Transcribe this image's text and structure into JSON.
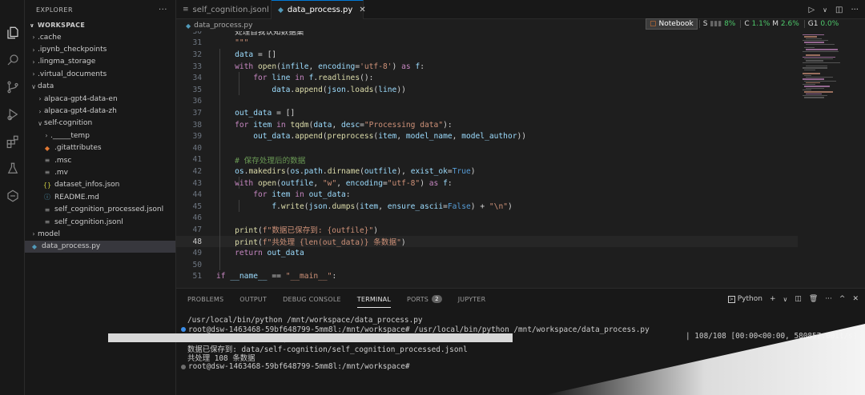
{
  "activity_bar": {
    "icons": [
      "files-icon",
      "search-icon",
      "source-control-icon",
      "run-debug-icon",
      "extensions-icon",
      "testing-icon",
      "remote-explorer-icon"
    ]
  },
  "sidebar": {
    "title": "EXPLORER",
    "workspace": "WORKSPACE",
    "items": [
      {
        "label": ".cache",
        "type": "folder",
        "expanded": false,
        "depth": 1
      },
      {
        "label": ".ipynb_checkpoints",
        "type": "folder",
        "expanded": false,
        "depth": 1
      },
      {
        "label": ".lingma_storage",
        "type": "folder",
        "expanded": false,
        "depth": 1
      },
      {
        "label": ".virtual_documents",
        "type": "folder",
        "expanded": false,
        "depth": 1
      },
      {
        "label": "data",
        "type": "folder",
        "expanded": true,
        "depth": 1
      },
      {
        "label": "alpaca-gpt4-data-en",
        "type": "folder",
        "expanded": false,
        "depth": 2
      },
      {
        "label": "alpaca-gpt4-data-zh",
        "type": "folder",
        "expanded": false,
        "depth": 2
      },
      {
        "label": "self-cognition",
        "type": "folder",
        "expanded": true,
        "depth": 2
      },
      {
        "label": "._____temp",
        "type": "folder",
        "expanded": false,
        "depth": 3
      },
      {
        "label": ".gitattributes",
        "type": "git",
        "depth": 3
      },
      {
        "label": ".msc",
        "type": "file",
        "depth": 3
      },
      {
        "label": ".mv",
        "type": "file",
        "depth": 3
      },
      {
        "label": "dataset_infos.json",
        "type": "json",
        "depth": 3
      },
      {
        "label": "README.md",
        "type": "md",
        "depth": 3
      },
      {
        "label": "self_cognition_processed.jsonl",
        "type": "file",
        "depth": 3
      },
      {
        "label": "self_cognition.jsonl",
        "type": "file",
        "depth": 3
      },
      {
        "label": "model",
        "type": "folder",
        "expanded": false,
        "depth": 1
      },
      {
        "label": "data_process.py",
        "type": "py",
        "depth": 1,
        "active": true
      }
    ]
  },
  "tabs": [
    {
      "label": "self_cognition.jsonl",
      "active": false
    },
    {
      "label": "data_process.py",
      "active": true
    }
  ],
  "breadcrumb": "data_process.py",
  "status_widget": {
    "notebook": "Notebook",
    "s_label": "S",
    "s_value": "8%",
    "c_label": "C",
    "c_value": "1.1%",
    "m_label": "M",
    "m_value": "2.6%",
    "g_label": "G1",
    "g_value": "0.0%"
  },
  "editor": {
    "lines": [
      {
        "n": "30",
        "text": "    处理自我认知数据集"
      },
      {
        "n": "31",
        "text": "    \"\"\""
      },
      {
        "n": "32",
        "text": "    data = []"
      },
      {
        "n": "33",
        "text": "    with open(infile, encoding='utf-8') as f:"
      },
      {
        "n": "34",
        "text": "        for line in f.readlines():"
      },
      {
        "n": "35",
        "text": "            data.append(json.loads(line))"
      },
      {
        "n": "36",
        "text": ""
      },
      {
        "n": "37",
        "text": "    out_data = []"
      },
      {
        "n": "38",
        "text": "    for item in tqdm(data, desc=\"Processing data\"):"
      },
      {
        "n": "39",
        "text": "        out_data.append(preprocess(item, model_name, model_author))"
      },
      {
        "n": "40",
        "text": ""
      },
      {
        "n": "41",
        "text": "    # 保存处理后的数据"
      },
      {
        "n": "42",
        "text": "    os.makedirs(os.path.dirname(outfile), exist_ok=True)"
      },
      {
        "n": "43",
        "text": "    with open(outfile, \"w\", encoding=\"utf-8\") as f:"
      },
      {
        "n": "44",
        "text": "        for item in out_data:"
      },
      {
        "n": "45",
        "text": "            f.write(json.dumps(item, ensure_ascii=False) + \"\\n\")"
      },
      {
        "n": "46",
        "text": ""
      },
      {
        "n": "47",
        "text": "    print(f\"数据已保存到: {outfile}\")"
      },
      {
        "n": "48",
        "text": "    print(f\"共处理 {len(out_data)} 条数据\")"
      },
      {
        "n": "49",
        "text": "    return out_data"
      },
      {
        "n": "50",
        "text": ""
      },
      {
        "n": "51",
        "text": "if __name__ == \"__main__\":"
      }
    ],
    "current_line": "48"
  },
  "panel": {
    "tabs": [
      "PROBLEMS",
      "OUTPUT",
      "DEBUG CONSOLE",
      "TERMINAL",
      "PORTS",
      "JUPYTER"
    ],
    "active_tab": "TERMINAL",
    "ports_count": "2",
    "shell_label": "Python",
    "terminal": [
      "/usr/local/bin/python /mnt/workspace/data_process.py",
      "root@dsw-1463468-59bf648799-5mm8l:/mnt/workspace# /usr/local/bin/python /mnt/workspace/data_process.py",
      "Processing data: 100%|",
      "数据已保存到: data/self-cognition/self_cognition_processed.jsonl",
      "共处理 108 条数据",
      "root@dsw-1463468-59bf648799-5mm8l:/mnt/workspace#"
    ],
    "progress_tail": "| 108/108 [00:00<00:00, 580857.00it/s]",
    "progress": 1.0
  }
}
